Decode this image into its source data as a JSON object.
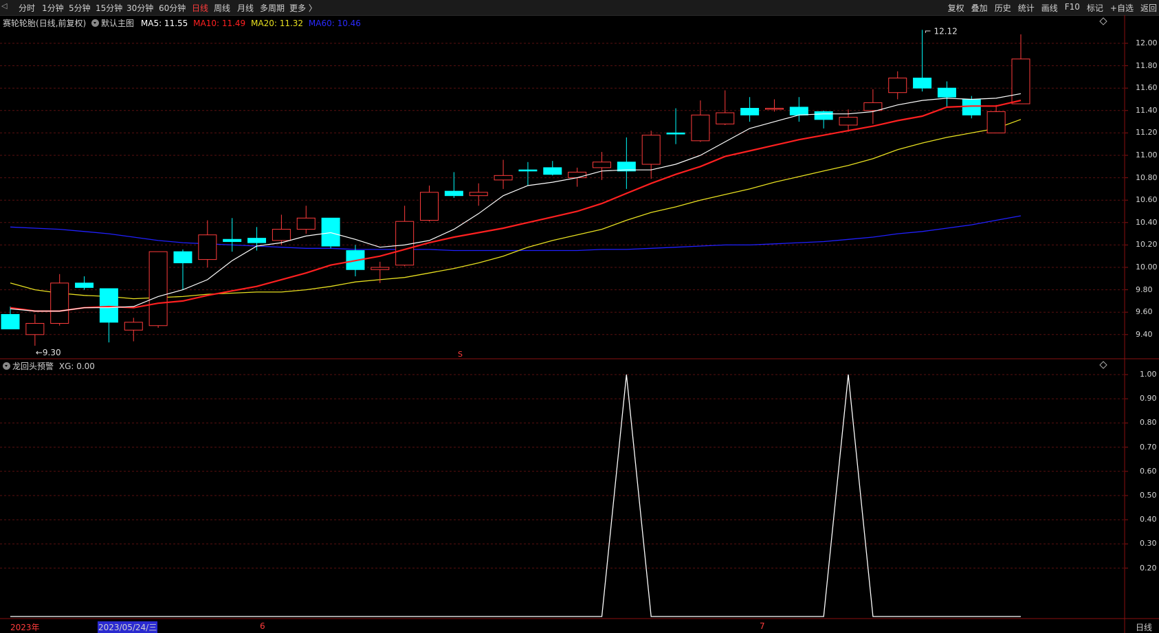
{
  "toolbar": {
    "back_icon": "back-arrow-icon",
    "periods": [
      "分时",
      "1分钟",
      "5分钟",
      "15分钟",
      "30分钟",
      "60分钟",
      "日线",
      "周线",
      "月线",
      "多周期",
      "更多 〉"
    ],
    "active_period": "日线",
    "right_items": [
      "复权",
      "叠加",
      "历史",
      "统计",
      "画线",
      "F10",
      "标记",
      "+自选",
      "返回"
    ]
  },
  "main_panel": {
    "stock_name": "赛轮轮胎",
    "chart_mode": "(日线,前复权)",
    "indicator_name": "默认主图",
    "ma5": {
      "label": "MA5: 11.55",
      "color": "#ffffff"
    },
    "ma10": {
      "label": "MA10: 11.49",
      "color": "#ff2020"
    },
    "ma20": {
      "label": "MA20: 11.32",
      "color": "#e8e020"
    },
    "ma60": {
      "label": "MA60: 10.46",
      "color": "#2020ff"
    },
    "high_marker": "12.12",
    "low_marker": "←9.30",
    "s_marker": "S",
    "y_ticks": [
      "12.00",
      "11.80",
      "11.60",
      "11.40",
      "11.20",
      "11.00",
      "10.80",
      "10.60",
      "10.40",
      "10.20",
      "10.00",
      "9.80",
      "9.60",
      "9.40"
    ],
    "diamond_icon": "diamond-icon"
  },
  "sub_panel": {
    "indicator_name": "龙回头预警",
    "value_label": "XG: 0.00",
    "y_ticks": [
      "1.00",
      "0.90",
      "0.80",
      "0.70",
      "0.60",
      "0.50",
      "0.40",
      "0.30",
      "0.20"
    ],
    "diamond_icon": "diamond-icon"
  },
  "date_axis": {
    "labels": [
      "2023年",
      "2023/05/24/三",
      "6",
      "7"
    ],
    "period": "日线"
  },
  "colors": {
    "up": "#ff3c3c",
    "down": "#00ffff",
    "ma5": "#ffffff",
    "ma10": "#ff2020",
    "ma20": "#e8e020",
    "ma60": "#2020ff",
    "grid": "#5a1010",
    "border": "#8a1010"
  },
  "chart_data": {
    "type": "candlestick",
    "title": "赛轮轮胎 (日线,前复权)",
    "ylim": [
      9.25,
      12.25
    ],
    "candles": [
      {
        "o": 9.58,
        "h": 9.65,
        "l": 9.45,
        "c": 9.45
      },
      {
        "o": 9.4,
        "h": 9.58,
        "l": 9.3,
        "c": 9.5
      },
      {
        "o": 9.5,
        "h": 9.94,
        "l": 9.48,
        "c": 9.86
      },
      {
        "o": 9.86,
        "h": 9.92,
        "l": 9.8,
        "c": 9.82
      },
      {
        "o": 9.81,
        "h": 9.81,
        "l": 9.33,
        "c": 9.51
      },
      {
        "o": 9.44,
        "h": 9.55,
        "l": 9.34,
        "c": 9.51
      },
      {
        "o": 9.48,
        "h": 10.14,
        "l": 9.46,
        "c": 10.14
      },
      {
        "o": 10.14,
        "h": 10.16,
        "l": 9.8,
        "c": 10.04
      },
      {
        "o": 10.07,
        "h": 10.42,
        "l": 10.0,
        "c": 10.29
      },
      {
        "o": 10.25,
        "h": 10.44,
        "l": 10.14,
        "c": 10.23
      },
      {
        "o": 10.26,
        "h": 10.36,
        "l": 10.15,
        "c": 10.22
      },
      {
        "o": 10.24,
        "h": 10.47,
        "l": 10.2,
        "c": 10.34
      },
      {
        "o": 10.34,
        "h": 10.55,
        "l": 10.3,
        "c": 10.44
      },
      {
        "o": 10.44,
        "h": 10.44,
        "l": 10.17,
        "c": 10.19
      },
      {
        "o": 10.15,
        "h": 10.2,
        "l": 9.92,
        "c": 9.98
      },
      {
        "o": 9.98,
        "h": 10.05,
        "l": 9.86,
        "c": 10.0
      },
      {
        "o": 10.02,
        "h": 10.55,
        "l": 10.01,
        "c": 10.41
      },
      {
        "o": 10.42,
        "h": 10.73,
        "l": 10.41,
        "c": 10.67
      },
      {
        "o": 10.68,
        "h": 10.85,
        "l": 10.62,
        "c": 10.64
      },
      {
        "o": 10.64,
        "h": 10.75,
        "l": 10.55,
        "c": 10.67
      },
      {
        "o": 10.78,
        "h": 10.96,
        "l": 10.7,
        "c": 10.82
      },
      {
        "o": 10.87,
        "h": 10.94,
        "l": 10.73,
        "c": 10.86
      },
      {
        "o": 10.89,
        "h": 10.95,
        "l": 10.82,
        "c": 10.83
      },
      {
        "o": 10.8,
        "h": 10.89,
        "l": 10.72,
        "c": 10.85
      },
      {
        "o": 10.89,
        "h": 11.03,
        "l": 10.78,
        "c": 10.94
      },
      {
        "o": 10.94,
        "h": 11.16,
        "l": 10.7,
        "c": 10.86
      },
      {
        "o": 10.92,
        "h": 11.22,
        "l": 10.79,
        "c": 11.18
      },
      {
        "o": 11.2,
        "h": 11.42,
        "l": 11.1,
        "c": 11.19
      },
      {
        "o": 11.13,
        "h": 11.49,
        "l": 11.12,
        "c": 11.36
      },
      {
        "o": 11.28,
        "h": 11.58,
        "l": 11.27,
        "c": 11.38
      },
      {
        "o": 11.42,
        "h": 11.52,
        "l": 11.3,
        "c": 11.36
      },
      {
        "o": 11.42,
        "h": 11.5,
        "l": 11.39,
        "c": 11.42
      },
      {
        "o": 11.43,
        "h": 11.52,
        "l": 11.3,
        "c": 11.36
      },
      {
        "o": 11.39,
        "h": 11.4,
        "l": 11.24,
        "c": 11.32
      },
      {
        "o": 11.27,
        "h": 11.41,
        "l": 11.21,
        "c": 11.34
      },
      {
        "o": 11.4,
        "h": 11.59,
        "l": 11.28,
        "c": 11.47
      },
      {
        "o": 11.56,
        "h": 11.75,
        "l": 11.5,
        "c": 11.69
      },
      {
        "o": 11.69,
        "h": 12.12,
        "l": 11.57,
        "c": 11.6
      },
      {
        "o": 11.6,
        "h": 11.66,
        "l": 11.43,
        "c": 11.52
      },
      {
        "o": 11.5,
        "h": 11.53,
        "l": 11.33,
        "c": 11.36
      },
      {
        "o": 11.2,
        "h": 11.45,
        "l": 11.2,
        "c": 11.39
      },
      {
        "o": 11.46,
        "h": 12.08,
        "l": 11.46,
        "c": 11.86
      }
    ],
    "ma5": [
      9.63,
      9.61,
      9.61,
      9.64,
      9.64,
      9.65,
      9.74,
      9.8,
      9.89,
      10.06,
      10.19,
      10.22,
      10.28,
      10.31,
      10.25,
      10.18,
      10.2,
      10.24,
      10.34,
      10.48,
      10.64,
      10.73,
      10.76,
      10.8,
      10.86,
      10.87,
      10.87,
      10.92,
      11.0,
      11.12,
      11.24,
      11.3,
      11.36,
      11.37,
      11.37,
      11.39,
      11.45,
      11.49,
      11.51,
      11.5,
      11.51,
      11.55
    ],
    "ma10": [
      9.64,
      9.61,
      9.61,
      9.64,
      9.65,
      9.64,
      9.68,
      9.7,
      9.75,
      9.79,
      9.83,
      9.89,
      9.95,
      10.02,
      10.06,
      10.1,
      10.16,
      10.22,
      10.27,
      10.31,
      10.35,
      10.4,
      10.45,
      10.5,
      10.57,
      10.66,
      10.75,
      10.83,
      10.9,
      10.99,
      11.04,
      11.09,
      11.14,
      11.18,
      11.22,
      11.26,
      11.31,
      11.35,
      11.43,
      11.44,
      11.44,
      11.49
    ],
    "ma20": [
      9.86,
      9.8,
      9.77,
      9.75,
      9.74,
      9.72,
      9.73,
      9.74,
      9.76,
      9.77,
      9.78,
      9.78,
      9.8,
      9.83,
      9.87,
      9.89,
      9.91,
      9.95,
      9.99,
      10.04,
      10.1,
      10.18,
      10.24,
      10.29,
      10.34,
      10.42,
      10.49,
      10.54,
      10.6,
      10.65,
      10.7,
      10.76,
      10.81,
      10.86,
      10.91,
      10.97,
      11.05,
      11.11,
      11.16,
      11.2,
      11.24,
      11.32
    ],
    "ma60": [
      10.36,
      10.35,
      10.34,
      10.32,
      10.3,
      10.27,
      10.24,
      10.22,
      10.21,
      10.2,
      10.19,
      10.18,
      10.17,
      10.17,
      10.16,
      10.16,
      10.16,
      10.16,
      10.15,
      10.15,
      10.15,
      10.15,
      10.15,
      10.15,
      10.16,
      10.16,
      10.17,
      10.18,
      10.19,
      10.2,
      10.2,
      10.21,
      10.22,
      10.23,
      10.25,
      10.27,
      10.3,
      10.32,
      10.35,
      10.38,
      10.42,
      10.46
    ],
    "indicator": {
      "name": "龙回头预警 XG",
      "ylim": [
        0,
        1.0
      ],
      "signal_indices": [
        25,
        34
      ],
      "values": [
        0,
        0,
        0,
        0,
        0,
        0,
        0,
        0,
        0,
        0,
        0,
        0,
        0,
        0,
        0,
        0,
        0,
        0,
        0,
        0,
        0,
        0,
        0,
        0,
        0,
        1,
        0,
        0,
        0,
        0,
        0,
        0,
        0,
        0,
        1,
        0,
        0,
        0,
        0,
        0,
        0,
        0
      ]
    }
  }
}
